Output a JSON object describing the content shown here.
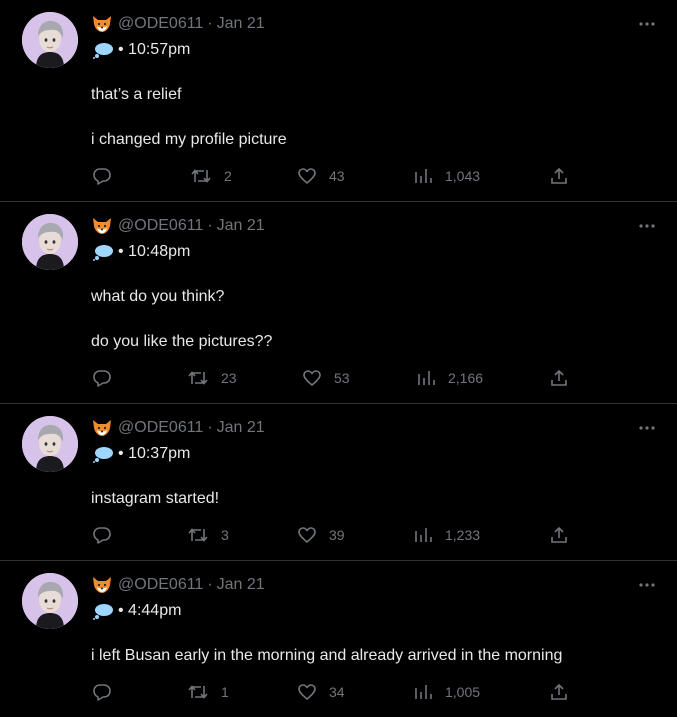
{
  "tweets": [
    {
      "handle": "@ODE0611",
      "separator": "·",
      "date": "Jan 21",
      "time_line": "• 10:57pm",
      "paragraphs": [
        "that’s a relief",
        "i changed my profile picture"
      ],
      "retweets": "2",
      "likes": "43",
      "views": "1,043"
    },
    {
      "handle": "@ODE0611",
      "separator": "·",
      "date": "Jan 21",
      "time_line": "• 10:48pm",
      "paragraphs": [
        "what do you think?",
        "do you like the pictures??"
      ],
      "retweets": "23",
      "likes": "53",
      "views": "2,166"
    },
    {
      "handle": "@ODE0611",
      "separator": "·",
      "date": "Jan 21",
      "time_line": "• 10:37pm",
      "paragraphs": [
        "instagram started!"
      ],
      "retweets": "3",
      "likes": "39",
      "views": "1,233"
    },
    {
      "handle": "@ODE0611",
      "separator": "·",
      "date": "Jan 21",
      "time_line": "• 4:44pm",
      "paragraphs": [
        "i left Busan early in the morning and already arrived in the morning"
      ],
      "retweets": "1",
      "likes": "34",
      "views": "1,005"
    }
  ],
  "icons": {
    "header_emoji": "fox-face-icon",
    "time_emoji": "thought-balloon-icon",
    "more": "more-options-icon",
    "reply": "reply-icon",
    "retweet": "retweet-icon",
    "like": "heart-icon",
    "views": "views-icon",
    "share": "share-icon"
  },
  "colors": {
    "background": "#000000",
    "text": "#e7e9ea",
    "muted": "#71767b",
    "divider": "#2f3336",
    "avatar_bg": "#d7c3ea"
  }
}
